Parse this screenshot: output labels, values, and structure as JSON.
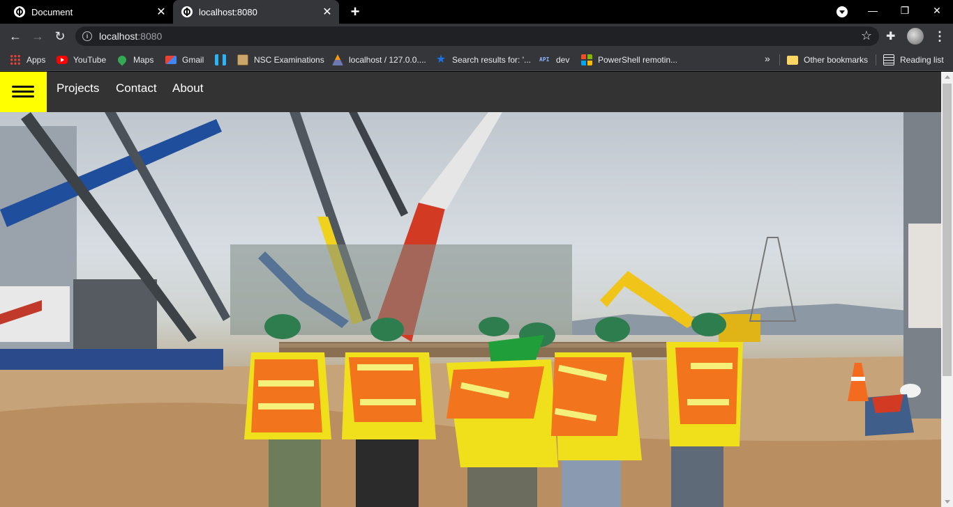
{
  "browser": {
    "tabs": [
      {
        "title": "Document",
        "active": false
      },
      {
        "title": "localhost:8080",
        "active": true
      }
    ],
    "address": {
      "host": "localhost",
      "port": ":8080"
    },
    "bookmarks": [
      {
        "label": "Apps",
        "icon": "apps-grid-icon"
      },
      {
        "label": "YouTube",
        "icon": "youtube-icon"
      },
      {
        "label": "Maps",
        "icon": "maps-pin-icon"
      },
      {
        "label": "Gmail",
        "icon": "gmail-icon"
      },
      {
        "label": "",
        "icon": "hi-logo-icon"
      },
      {
        "label": "NSC Examinations",
        "icon": "nsc-crest-icon"
      },
      {
        "label": "localhost / 127.0.0....",
        "icon": "phpmyadmin-icon"
      },
      {
        "label": "Search results for: '...",
        "icon": "star-icon"
      },
      {
        "label": "dev",
        "icon": "api-icon"
      },
      {
        "label": "PowerShell remotin...",
        "icon": "microsoft-icon"
      }
    ],
    "other_bookmarks": "Other bookmarks",
    "reading_list": "Reading list"
  },
  "site": {
    "nav": {
      "links": [
        "Projects",
        "Contact",
        "About"
      ],
      "menu_color": "#ffff00"
    },
    "hero": {
      "alt": "Construction workers carrying a beam at a building site with cranes"
    }
  }
}
